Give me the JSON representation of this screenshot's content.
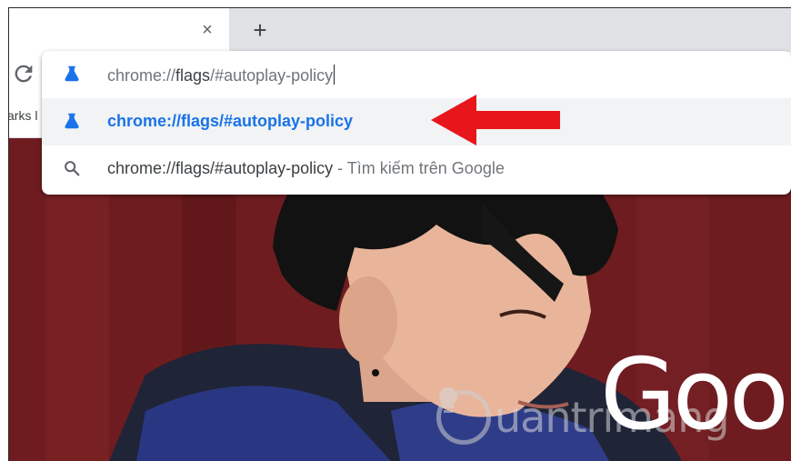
{
  "tabstrip": {
    "close_glyph": "×",
    "new_tab_glyph": "+"
  },
  "toolbar": {
    "reload_icon": "reload-icon",
    "bookmarks_partial": "arks l"
  },
  "omnibox": {
    "input": {
      "prefix": "chrome://",
      "host": "flags",
      "rest": "/#autoplay-policy",
      "icon": "flask-icon"
    },
    "suggestions": [
      {
        "text": "chrome://flags/#autoplay-policy",
        "icon": "flask-icon",
        "selected": true
      },
      {
        "text": "chrome://flags/#autoplay-policy",
        "suffix": " - Tìm kiếm trên Google",
        "icon": "search-icon",
        "selected": false
      }
    ],
    "accent": "#1a73e8",
    "selected_bg": "#f1f3f4"
  },
  "annotation": {
    "arrow_color": "#e8151b"
  },
  "page": {
    "logo_text": "Goo",
    "watermark": "uantrimang"
  }
}
